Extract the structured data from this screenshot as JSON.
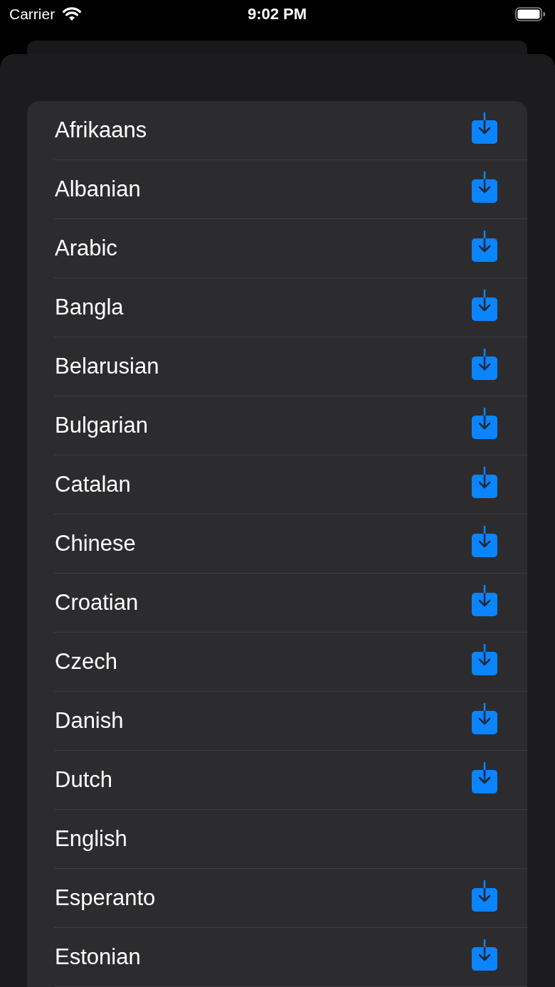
{
  "status_bar": {
    "carrier": "Carrier",
    "time": "9:02 PM"
  },
  "languages": [
    {
      "name": "Afrikaans",
      "download_available": true
    },
    {
      "name": "Albanian",
      "download_available": true
    },
    {
      "name": "Arabic",
      "download_available": true
    },
    {
      "name": "Bangla",
      "download_available": true
    },
    {
      "name": "Belarusian",
      "download_available": true
    },
    {
      "name": "Bulgarian",
      "download_available": true
    },
    {
      "name": "Catalan",
      "download_available": true
    },
    {
      "name": "Chinese",
      "download_available": true
    },
    {
      "name": "Croatian",
      "download_available": true
    },
    {
      "name": "Czech",
      "download_available": true
    },
    {
      "name": "Danish",
      "download_available": true
    },
    {
      "name": "Dutch",
      "download_available": true
    },
    {
      "name": "English",
      "download_available": false
    },
    {
      "name": "Esperanto",
      "download_available": true
    },
    {
      "name": "Estonian",
      "download_available": true
    }
  ]
}
